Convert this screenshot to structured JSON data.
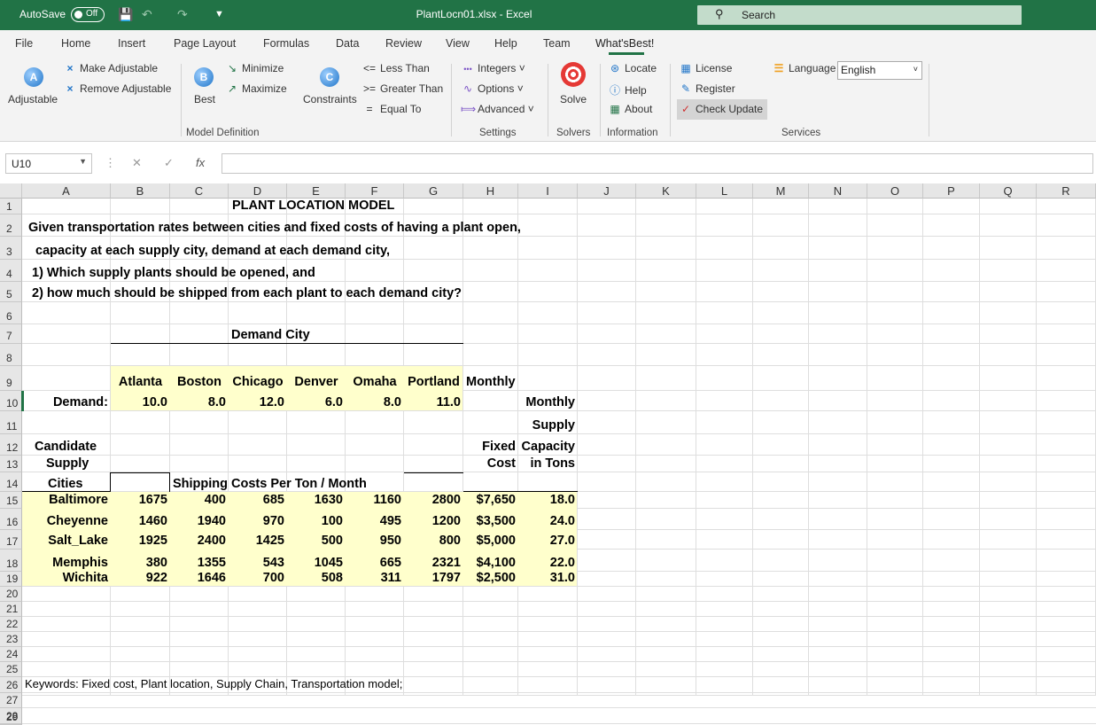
{
  "titlebar": {
    "autosave_label": "AutoSave",
    "autosave_state": "Off",
    "document_title": "PlantLocn01.xlsx  -  Excel",
    "search_placeholder": "Search"
  },
  "tabs": [
    "File",
    "Home",
    "Insert",
    "Page Layout",
    "Formulas",
    "Data",
    "Review",
    "View",
    "Help",
    "Team",
    "What'sBest!"
  ],
  "active_tab": "What'sBest!",
  "ribbon": {
    "adjustable": "Adjustable",
    "make_adjustable": "Make Adjustable",
    "remove_adjustable": "Remove Adjustable",
    "best": "Best",
    "minimize": "Minimize",
    "maximize": "Maximize",
    "constraints": "Constraints",
    "less_than": "Less Than",
    "greater_than": "Greater Than",
    "equal_to": "Equal To",
    "model_definition": "Model Definition",
    "integers": "Integers",
    "options": "Options",
    "advanced": "Advanced",
    "settings": "Settings",
    "solve": "Solve",
    "solvers": "Solvers",
    "locate": "Locate",
    "help": "Help",
    "about": "About",
    "information": "Information",
    "license": "License",
    "register": "Register",
    "check_update": "Check Update",
    "language_label": "Language",
    "language_value": "English",
    "services": "Services",
    "icons": {
      "less_than_symbol": "<=",
      "greater_than_symbol": ">=",
      "equal_symbol": "="
    }
  },
  "formula_bar": {
    "name_box": "U10",
    "formula": ""
  },
  "columns": [
    "A",
    "B",
    "C",
    "D",
    "E",
    "F",
    "G",
    "H",
    "I",
    "J",
    "K",
    "L",
    "M",
    "N",
    "O",
    "P",
    "Q",
    "R"
  ],
  "rows": [
    "1",
    "2",
    "3",
    "4",
    "5",
    "6",
    "7",
    "8",
    "9",
    "10",
    "11",
    "12",
    "13",
    "14",
    "15",
    "16",
    "17",
    "18",
    "19",
    "20",
    "21",
    "22",
    "23",
    "24",
    "25",
    "26",
    "27",
    "28",
    "29"
  ],
  "sheet": {
    "title": "PLANT LOCATION MODEL",
    "desc": [
      "Given transportation rates between cities and fixed costs of having a plant open,",
      "capacity at each supply city, demand at each demand city,",
      "1) Which supply plants should be opened, and",
      "2) how much should be shipped from each plant to each demand city?"
    ],
    "demand_city_header": "Demand City",
    "demand_cities": [
      "Atlanta",
      "Boston",
      "Chicago",
      "Denver",
      "Omaha",
      "Portland"
    ],
    "monthly_h9": "Monthly",
    "demand_label": "Demand:",
    "demand_values": [
      "10.0",
      "8.0",
      "12.0",
      "6.0",
      "8.0",
      "11.0"
    ],
    "monthly_i10": "Monthly",
    "supply_i11": "Supply",
    "candidate": "Candidate",
    "fixed": "Fixed",
    "capacity": "Capacity",
    "supply_a13": "Supply",
    "cost": "Cost",
    "in_tons": "in Tons",
    "cities_label": "Cities",
    "shipping_header": "Shipping Costs Per Ton / Month",
    "supply_rows": [
      {
        "city": "Baltimore",
        "costs": [
          "1675",
          "400",
          "685",
          "1630",
          "1160",
          "2800"
        ],
        "fixed": "$7,650",
        "capacity": "18.0"
      },
      {
        "city": "Cheyenne",
        "costs": [
          "1460",
          "1940",
          "970",
          "100",
          "495",
          "1200"
        ],
        "fixed": "$3,500",
        "capacity": "24.0"
      },
      {
        "city": "Salt_Lake",
        "costs": [
          "1925",
          "2400",
          "1425",
          "500",
          "950",
          "800"
        ],
        "fixed": "$5,000",
        "capacity": "27.0"
      },
      {
        "city": "Memphis",
        "costs": [
          "380",
          "1355",
          "543",
          "1045",
          "665",
          "2321"
        ],
        "fixed": "$4,100",
        "capacity": "22.0"
      },
      {
        "city": "Wichita",
        "costs": [
          "922",
          "1646",
          "700",
          "508",
          "311",
          "1797"
        ],
        "fixed": "$2,500",
        "capacity": "31.0"
      }
    ],
    "keywords": "Keywords:  Fixed cost,  Plant location,  Supply Chain,  Transportation model;"
  }
}
